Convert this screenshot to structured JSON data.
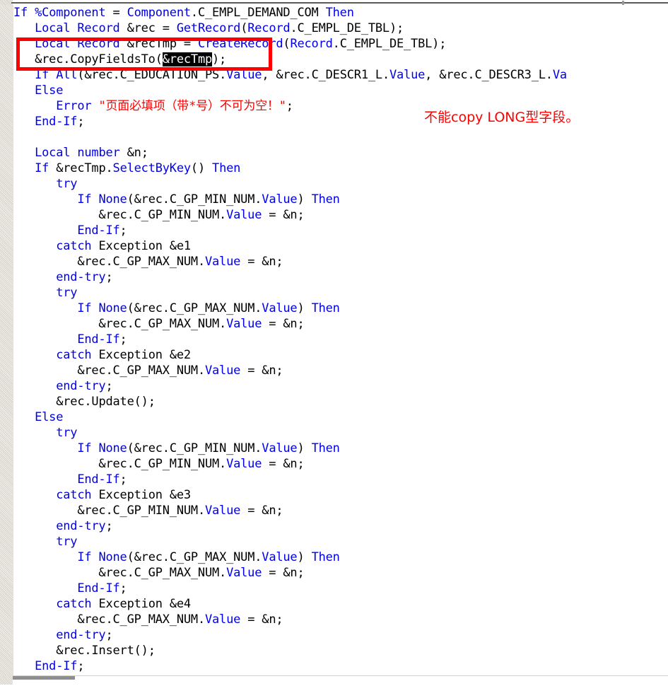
{
  "editor": {
    "language": "PeopleCode",
    "font_size_px": 17,
    "colors": {
      "keyword": "#0000ee",
      "identifier": "#000000",
      "string": "#ff0000",
      "selection_bg": "#000000",
      "selection_fg": "#ffffff",
      "annotation": "#ff0000",
      "background": "#ffffff",
      "gutter": "#e8e5de"
    },
    "selection_text": "&recTmp",
    "lines": [
      "If %Component = Component.C_EMPL_DEMAND_COM Then",
      "   Local Record &rec = GetRecord(Record.C_EMPL_DE_TBL);",
      "   Local Record &recTmp = CreateRecord(Record.C_EMPL_DE_TBL);",
      "   &rec.CopyFieldsTo(&recTmp);",
      "   If All(&rec.C_EDUCATION_PS.Value, &rec.C_DESCR1_L.Value, &rec.C_DESCR3_L.Va",
      "   Else",
      "      Error \"页面必填项（带*号）不可为空！\";",
      "   End-If;",
      "",
      "   Local number &n;",
      "   If &recTmp.SelectByKey() Then",
      "      try",
      "         If None(&rec.C_GP_MIN_NUM.Value) Then",
      "            &rec.C_GP_MIN_NUM.Value = &n;",
      "         End-If;",
      "      catch Exception &e1",
      "         &rec.C_GP_MAX_NUM.Value = &n;",
      "      end-try;",
      "      try",
      "         If None(&rec.C_GP_MAX_NUM.Value) Then",
      "            &rec.C_GP_MAX_NUM.Value = &n;",
      "         End-If;",
      "      catch Exception &e2",
      "         &rec.C_GP_MAX_NUM.Value = &n;",
      "      end-try;",
      "      &rec.Update();",
      "   Else",
      "      try",
      "         If None(&rec.C_GP_MIN_NUM.Value) Then",
      "            &rec.C_GP_MIN_NUM.Value = &n;",
      "         End-If;",
      "      catch Exception &e3",
      "         &rec.C_GP_MIN_NUM.Value = &n;",
      "      end-try;",
      "      try",
      "         If None(&rec.C_GP_MAX_NUM.Value) Then",
      "            &rec.C_GP_MAX_NUM.Value = &n;",
      "         End-If;",
      "      catch Exception &e4",
      "         &rec.C_GP_MAX_NUM.Value = &n;",
      "      end-try;",
      "      &rec.Insert();",
      "   End-If;"
    ]
  },
  "annotations": {
    "note_text": "不能copy LONG型字段。",
    "box_label": "highlight-rectangle"
  },
  "error_message": "页面必填项（带*号）不可为空！"
}
